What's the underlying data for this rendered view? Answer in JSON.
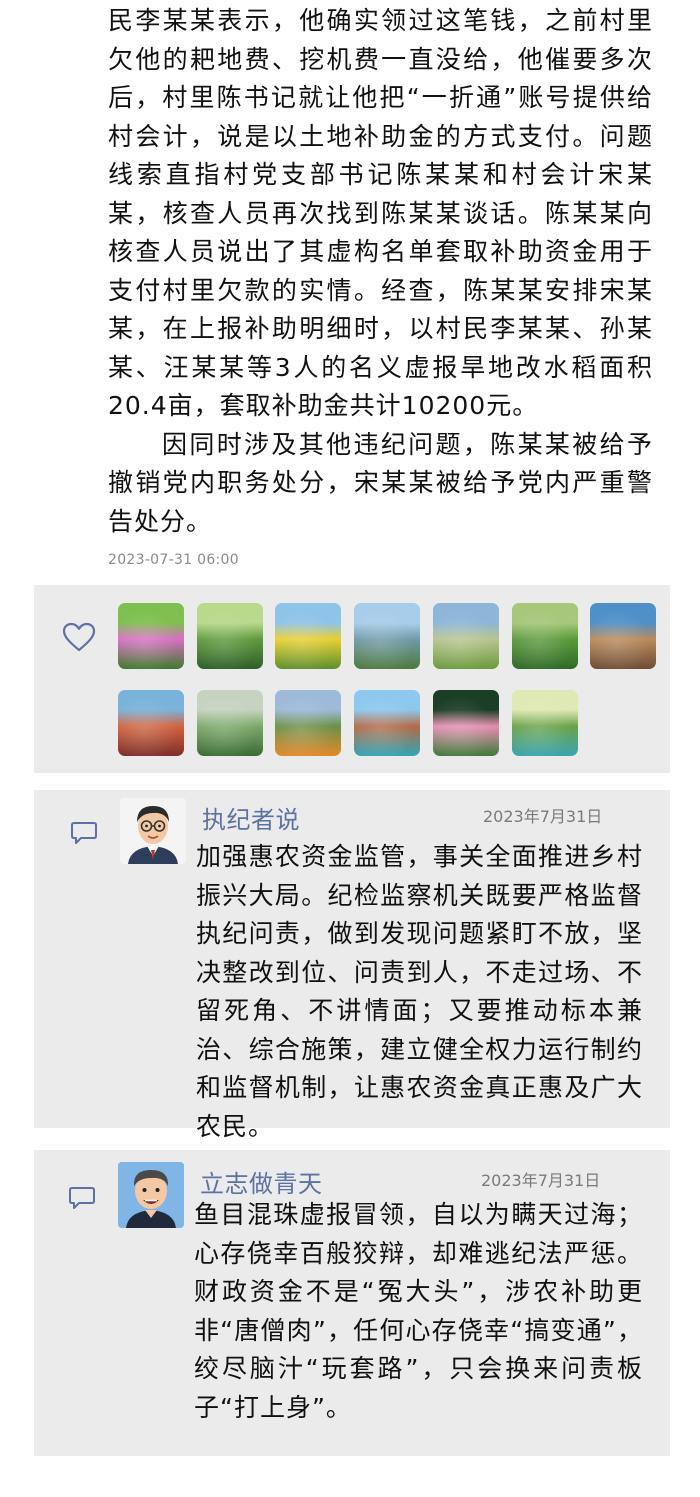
{
  "article": {
    "paragraphs": [
      "民李某某表示，他确实领过这笔钱，之前村里欠他的耙地费、挖机费一直没给，他催要多次后，村里陈书记就让他把“一折通”账号提供给村会计，说是以土地补助金的方式支付。问题线索直指村党支部书记陈某某和村会计宋某某，核查人员再次找到陈某某谈话。陈某某向核查人员说出了其虚构名单套取补助资金用于支付村里欠款的实情。经查，陈某某安排宋某某，在上报补助明细时，以村民李某某、孙某某、汪某某等3人的名义虚报旱地改水稻面积20.4亩，套取补助金共计10200元。",
      "因同时涉及其他违纪问题，陈某某被给予撤销党内职务处分，宋某某被给予党内严重警告处分。"
    ],
    "timestamp": "2023-07-31 06:00"
  },
  "gallery": {
    "like_icon": "heart-outline-icon",
    "thumbnails": [
      {
        "name": "bird-flowers-thumbnail",
        "colors": [
          "#7fbf4f",
          "#d86ec3",
          "#3f7a2c"
        ]
      },
      {
        "name": "green-hills-thumbnail",
        "colors": [
          "#b9d98c",
          "#5e9a3b",
          "#2f5f2a"
        ]
      },
      {
        "name": "rapeseed-field-thumbnail",
        "colors": [
          "#8fc3ea",
          "#e8cf2f",
          "#5d8f2f"
        ]
      },
      {
        "name": "valley-river-thumbnail",
        "colors": [
          "#a8cdea",
          "#6f9aa8",
          "#4f7a3d"
        ]
      },
      {
        "name": "rainbow-meadow-thumbnail",
        "colors": [
          "#8eb6d8",
          "#b7c48f",
          "#6b9b3c"
        ]
      },
      {
        "name": "wheat-field-thumbnail",
        "colors": [
          "#a7c77a",
          "#5a9a3a",
          "#2f6a28"
        ]
      },
      {
        "name": "desert-mountains-thumbnail",
        "colors": [
          "#4f90c8",
          "#b98a5a",
          "#6e4c36"
        ]
      },
      {
        "name": "red-dunes-thumbnail",
        "colors": [
          "#7ab3da",
          "#d2643f",
          "#7e2e2a"
        ]
      },
      {
        "name": "rice-terraces-thumbnail",
        "colors": [
          "#c6d3c0",
          "#7ca86a",
          "#3c6b35"
        ]
      },
      {
        "name": "wildflowers-thumbnail",
        "colors": [
          "#9dbbd9",
          "#6d8f48",
          "#e48a2a"
        ]
      },
      {
        "name": "coastal-rocks-thumbnail",
        "colors": [
          "#8ec8ef",
          "#b46a47",
          "#31a6b8"
        ]
      },
      {
        "name": "lotus-flower-thumbnail",
        "colors": [
          "#1b3f26",
          "#e58fb1",
          "#3f7a3a"
        ]
      },
      {
        "name": "forest-waterfall-thumbnail",
        "colors": [
          "#dfe9b5",
          "#6aa248",
          "#3aa5b0"
        ]
      }
    ]
  },
  "comments": [
    {
      "name": "执纪者说",
      "date": "2023年7月31日",
      "text": "加强惠农资金监管，事关全面推进乡村振兴大局。纪检监察机关既要严格监督执纪问责，做到发现问题紧盯不放，坚决整改到位、问责到人，不走过场、不留死角、不讲情面；又要推动标本兼治、综合施策，建立健全权力运行制约和监督机制，让惠农资金真正惠及广大农民。"
    },
    {
      "name": "立志做青天",
      "date": "2023年7月31日",
      "text": "鱼目混珠虚报冒领，自以为瞒天过海；心存侥幸百般狡辩，却难逃纪法严惩。财政资金不是“冤大头”，涉农补助更非“唐僧肉”，任何心存侥幸“搞变通”，绞尽脑汁“玩套路”，只会换来问责板子“打上身”。"
    }
  ],
  "colors": {
    "card_bg": "#ebebeb",
    "name_color": "#5b72a3",
    "icon_color": "#5b72a3"
  }
}
